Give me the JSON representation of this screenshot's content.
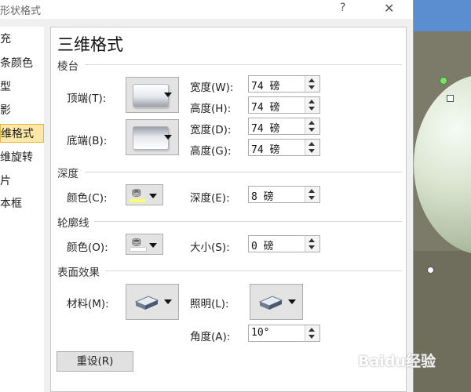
{
  "dialog": {
    "title_fragment": "形状格式",
    "help": "?",
    "close": "✕"
  },
  "sidebar": {
    "items": [
      "充",
      "条颜色",
      "型",
      "影",
      "维格式",
      "维旋转",
      "片",
      "本框"
    ],
    "selected_index": 4
  },
  "panel": {
    "title": "三维格式",
    "bevel": {
      "section": "棱台",
      "top_label": "顶端(T):",
      "bottom_label": "底端(B):",
      "top_width_label": "宽度(W):",
      "top_width_value": "74 磅",
      "top_height_label": "高度(H):",
      "top_height_value": "74 磅",
      "bottom_width_label": "宽度(D):",
      "bottom_width_value": "74 磅",
      "bottom_height_label": "高度(G):",
      "bottom_height_value": "74 磅"
    },
    "depth": {
      "section": "深度",
      "color_label": "颜色(C):",
      "depth_label": "深度(E):",
      "depth_value": "8 磅",
      "swatch_color": "#ffff66"
    },
    "contour": {
      "section": "轮廓线",
      "color_label": "颜色(O):",
      "size_label": "大小(S):",
      "size_value": "0 磅",
      "swatch_color": "#ffffff"
    },
    "surface": {
      "section": "表面效果",
      "material_label": "材料(M):",
      "lighting_label": "照明(L):",
      "angle_label": "角度(A):",
      "angle_value": "10°"
    },
    "reset_label": "重设(R)"
  },
  "watermark": "Baidu经验",
  "colors": {
    "selected_bg": "#fde8a8",
    "sphere": "#dbe6d2",
    "slide_bg": "#6f6d5c"
  }
}
